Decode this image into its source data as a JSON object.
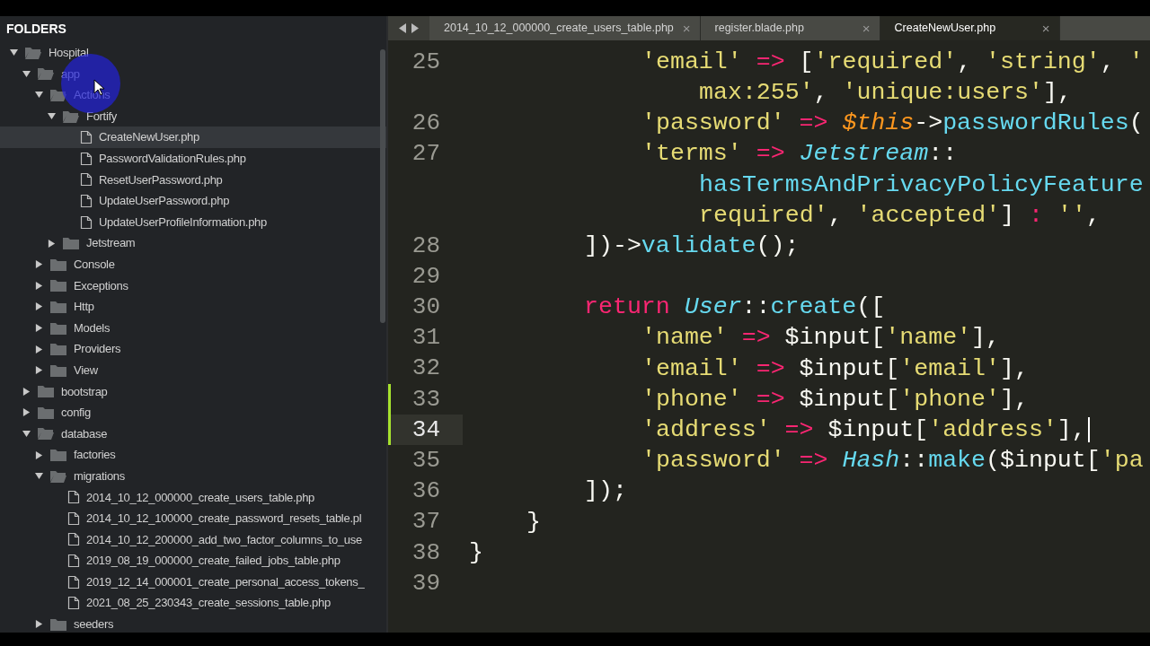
{
  "sidebar": {
    "title": "FOLDERS",
    "tree": [
      {
        "label": "Hospital",
        "kind": "folder",
        "expanded": true,
        "selected": false,
        "children": [
          {
            "label": "app",
            "kind": "folder",
            "expanded": true,
            "selected": false,
            "children": [
              {
                "label": "Actions",
                "kind": "folder",
                "expanded": true,
                "selected": false,
                "children": [
                  {
                    "label": "Fortify",
                    "kind": "folder",
                    "expanded": true,
                    "selected": false,
                    "children": [
                      {
                        "label": "CreateNewUser.php",
                        "kind": "file",
                        "selected": true
                      },
                      {
                        "label": "PasswordValidationRules.php",
                        "kind": "file",
                        "selected": false
                      },
                      {
                        "label": "ResetUserPassword.php",
                        "kind": "file",
                        "selected": false
                      },
                      {
                        "label": "UpdateUserPassword.php",
                        "kind": "file",
                        "selected": false
                      },
                      {
                        "label": "UpdateUserProfileInformation.php",
                        "kind": "file",
                        "selected": false
                      }
                    ]
                  },
                  {
                    "label": "Jetstream",
                    "kind": "folder",
                    "expanded": false,
                    "selected": false
                  }
                ]
              },
              {
                "label": "Console",
                "kind": "folder",
                "expanded": false,
                "selected": false
              },
              {
                "label": "Exceptions",
                "kind": "folder",
                "expanded": false,
                "selected": false
              },
              {
                "label": "Http",
                "kind": "folder",
                "expanded": false,
                "selected": false
              },
              {
                "label": "Models",
                "kind": "folder",
                "expanded": false,
                "selected": false
              },
              {
                "label": "Providers",
                "kind": "folder",
                "expanded": false,
                "selected": false
              },
              {
                "label": "View",
                "kind": "folder",
                "expanded": false,
                "selected": false
              }
            ]
          },
          {
            "label": "bootstrap",
            "kind": "folder",
            "expanded": false,
            "selected": false
          },
          {
            "label": "config",
            "kind": "folder",
            "expanded": false,
            "selected": false
          },
          {
            "label": "database",
            "kind": "folder",
            "expanded": true,
            "selected": false,
            "children": [
              {
                "label": "factories",
                "kind": "folder",
                "expanded": false,
                "selected": false
              },
              {
                "label": "migrations",
                "kind": "folder",
                "expanded": true,
                "selected": false,
                "children": [
                  {
                    "label": "2014_10_12_000000_create_users_table.php",
                    "kind": "file",
                    "selected": false
                  },
                  {
                    "label": "2014_10_12_100000_create_password_resets_table.pl",
                    "kind": "file",
                    "selected": false
                  },
                  {
                    "label": "2014_10_12_200000_add_two_factor_columns_to_use",
                    "kind": "file",
                    "selected": false
                  },
                  {
                    "label": "2019_08_19_000000_create_failed_jobs_table.php",
                    "kind": "file",
                    "selected": false
                  },
                  {
                    "label": "2019_12_14_000001_create_personal_access_tokens_",
                    "kind": "file",
                    "selected": false
                  },
                  {
                    "label": "2021_08_25_230343_create_sessions_table.php",
                    "kind": "file",
                    "selected": false
                  }
                ]
              },
              {
                "label": "seeders",
                "kind": "folder",
                "expanded": false,
                "selected": false
              }
            ]
          }
        ]
      }
    ]
  },
  "tabs": [
    {
      "label": "2014_10_12_000000_create_users_table.php",
      "selected": false
    },
    {
      "label": "register.blade.php",
      "selected": false
    },
    {
      "label": "CreateNewUser.php",
      "selected": true
    }
  ],
  "close_label": "×",
  "code": [
    {
      "number": "25",
      "current": false,
      "modified": false,
      "kind": "member",
      "tokens": [
        {
          "kind": "string",
          "text": "'email'"
        },
        {
          "kind": "operator",
          "text": " => "
        },
        {
          "kind": "plain",
          "text": "["
        },
        {
          "kind": "string",
          "text": "'required'"
        },
        {
          "kind": "plain",
          "text": ", "
        },
        {
          "kind": "string",
          "text": "'string'"
        },
        {
          "kind": "plain",
          "text": ", "
        },
        {
          "kind": "string",
          "text": "'"
        }
      ]
    },
    {
      "kind": "wrap",
      "tokens": [
        {
          "kind": "string",
          "text": "max:255'"
        },
        {
          "kind": "plain",
          "text": ", "
        },
        {
          "kind": "string",
          "text": "'unique:users'"
        },
        {
          "kind": "plain",
          "text": "],"
        }
      ]
    },
    {
      "number": "26",
      "current": false,
      "modified": false,
      "kind": "member",
      "tokens": [
        {
          "kind": "string",
          "text": "'password'"
        },
        {
          "kind": "operator",
          "text": " => "
        },
        {
          "kind": "variable",
          "text": "$this"
        },
        {
          "kind": "plain",
          "text": "->"
        },
        {
          "kind": "function",
          "text": "passwordRules"
        },
        {
          "kind": "plain",
          "text": "("
        }
      ]
    },
    {
      "number": "27",
      "current": false,
      "modified": false,
      "kind": "member",
      "tokens": [
        {
          "kind": "string",
          "text": "'terms'"
        },
        {
          "kind": "operator",
          "text": " => "
        },
        {
          "kind": "class",
          "text": "Jetstream"
        },
        {
          "kind": "plain",
          "text": "::"
        }
      ]
    },
    {
      "kind": "wrap",
      "tokens": [
        {
          "kind": "function",
          "text": "hasTermsAndPrivacyPolicyFeature"
        }
      ]
    },
    {
      "kind": "wrap",
      "tokens": [
        {
          "kind": "string",
          "text": "required'"
        },
        {
          "kind": "plain",
          "text": ", "
        },
        {
          "kind": "string",
          "text": "'accepted'"
        },
        {
          "kind": "plain",
          "text": "] "
        },
        {
          "kind": "operator",
          "text": ":"
        },
        {
          "kind": "string",
          "text": " ''"
        },
        {
          "kind": "plain",
          "text": ","
        }
      ]
    },
    {
      "number": "28",
      "current": false,
      "modified": false,
      "kind": "statement",
      "tokens": [
        {
          "kind": "plain",
          "text": "])->"
        },
        {
          "kind": "function",
          "text": "validate"
        },
        {
          "kind": "plain",
          "text": "();"
        }
      ]
    },
    {
      "number": "29",
      "current": false,
      "modified": false,
      "kind": "blank"
    },
    {
      "number": "30",
      "current": false,
      "modified": false,
      "kind": "statement",
      "tokens": [
        {
          "kind": "keyword",
          "text": "return "
        },
        {
          "kind": "class",
          "text": "User"
        },
        {
          "kind": "plain",
          "text": "::"
        },
        {
          "kind": "function",
          "text": "create"
        },
        {
          "kind": "plain",
          "text": "(["
        }
      ]
    },
    {
      "number": "31",
      "current": false,
      "modified": false,
      "kind": "member",
      "tokens": [
        {
          "kind": "string",
          "text": "'name'"
        },
        {
          "kind": "operator",
          "text": " => "
        },
        {
          "kind": "plain",
          "text": "$input["
        },
        {
          "kind": "string",
          "text": "'name'"
        },
        {
          "kind": "plain",
          "text": "],"
        }
      ]
    },
    {
      "number": "32",
      "current": false,
      "modified": false,
      "kind": "member",
      "tokens": [
        {
          "kind": "string",
          "text": "'email'"
        },
        {
          "kind": "operator",
          "text": " => "
        },
        {
          "kind": "plain",
          "text": "$input["
        },
        {
          "kind": "string",
          "text": "'email'"
        },
        {
          "kind": "plain",
          "text": "],"
        }
      ]
    },
    {
      "number": "33",
      "current": false,
      "modified": true,
      "kind": "member",
      "tokens": [
        {
          "kind": "string",
          "text": "'phone'"
        },
        {
          "kind": "operator",
          "text": " => "
        },
        {
          "kind": "plain",
          "text": "$input["
        },
        {
          "kind": "string",
          "text": "'phone'"
        },
        {
          "kind": "plain",
          "text": "],"
        }
      ]
    },
    {
      "number": "34",
      "current": true,
      "modified": true,
      "kind": "member",
      "tokens": [
        {
          "kind": "string",
          "text": "'address'"
        },
        {
          "kind": "operator",
          "text": " => "
        },
        {
          "kind": "plain",
          "text": "$input["
        },
        {
          "kind": "string",
          "text": "'address'"
        },
        {
          "kind": "plain",
          "text": "],"
        }
      ]
    },
    {
      "number": "35",
      "current": false,
      "modified": false,
      "kind": "member",
      "tokens": [
        {
          "kind": "string",
          "text": "'password'"
        },
        {
          "kind": "operator",
          "text": " => "
        },
        {
          "kind": "class",
          "text": "Hash"
        },
        {
          "kind": "plain",
          "text": "::"
        },
        {
          "kind": "function",
          "text": "make"
        },
        {
          "kind": "plain",
          "text": "($input["
        },
        {
          "kind": "string",
          "text": "'pa"
        }
      ]
    },
    {
      "number": "36",
      "current": false,
      "modified": false,
      "kind": "statement",
      "tokens": [
        {
          "kind": "plain",
          "text": "]);"
        }
      ]
    },
    {
      "number": "37",
      "current": false,
      "modified": false,
      "kind": "method",
      "tokens": [
        {
          "kind": "plain",
          "text": "}"
        }
      ]
    },
    {
      "number": "38",
      "current": false,
      "modified": false,
      "kind": "class",
      "tokens": [
        {
          "kind": "plain",
          "text": "}"
        }
      ]
    },
    {
      "number": "39",
      "current": false,
      "modified": false,
      "kind": "blank"
    }
  ]
}
